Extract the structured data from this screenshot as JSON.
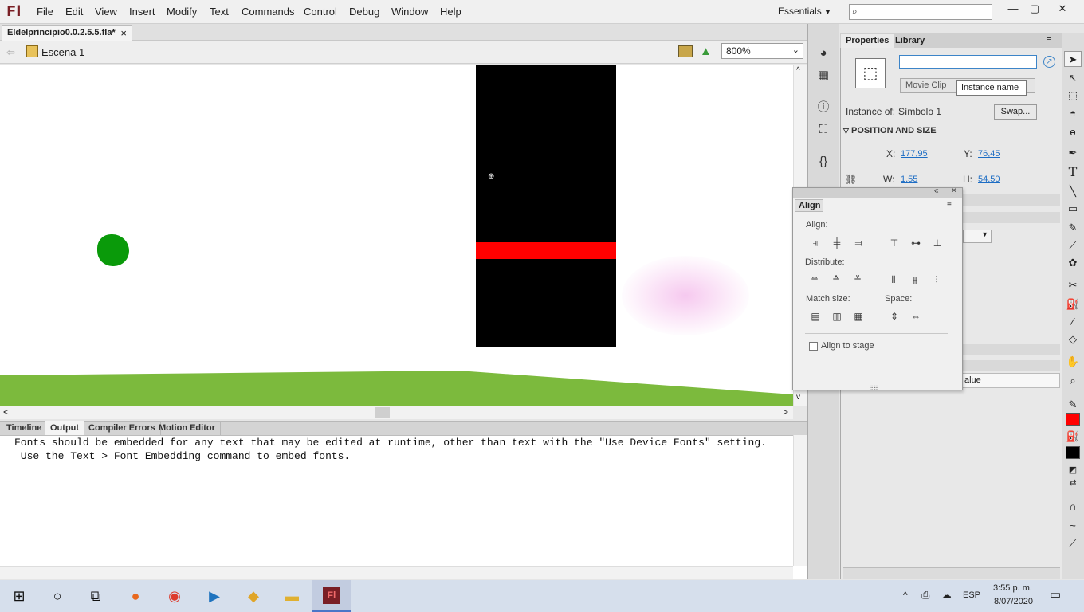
{
  "app": {
    "logo": "Fl",
    "menus": [
      "File",
      "Edit",
      "View",
      "Insert",
      "Modify",
      "Text",
      "Commands",
      "Control",
      "Debug",
      "Window",
      "Help"
    ],
    "workspace": "Essentials",
    "window_controls": [
      "—",
      "▢",
      "✕"
    ]
  },
  "document": {
    "tab_label": "Eldelprincipio0.0.2.5.5.fla*",
    "tab_close": "×",
    "scene_label": "Escena 1",
    "zoom_value": "800%"
  },
  "bottom_panel": {
    "tabs": [
      "Timeline",
      "Output",
      "Compiler Errors",
      "Motion Editor"
    ],
    "output_lines": [
      "Fonts should be embedded for any text that may be edited at runtime, other than text with the \"Use Device Fonts\" setting.",
      " Use the Text > Font Embedding command to embed fonts."
    ]
  },
  "properties": {
    "tabs": [
      "Properties",
      "Library"
    ],
    "symbol_type": "Movie Clip",
    "instance_name_tooltip": "Instance name",
    "instance_of_label": "Instance of:",
    "instance_of_value": "Símbolo 1",
    "swap_label": "Swap...",
    "section_title": "POSITION AND SIZE",
    "x_label": "X:",
    "x_value": "177,95",
    "y_label": "Y:",
    "y_value": "76,45",
    "w_label": "W:",
    "w_value": "1,55",
    "h_label": "H:",
    "h_value": "54,50",
    "value_col_label": "alue"
  },
  "align_panel": {
    "tab": "Align",
    "align_label": "Align:",
    "distribute_label": "Distribute:",
    "match_size_label": "Match size:",
    "space_label": "Space:",
    "align_to_stage_label": "Align to stage"
  },
  "taskbar": {
    "language": "ESP",
    "time": "3:55 p. m.",
    "date": "8/07/2020"
  },
  "colors": {
    "stroke_color": "#ff0000",
    "fill_color": "#000000",
    "accent": "#3c84c8",
    "stage_bar": "#000000",
    "stage_stripe": "#ff0000",
    "ground": "#7cba3d",
    "blob": "#0a9a0a"
  }
}
